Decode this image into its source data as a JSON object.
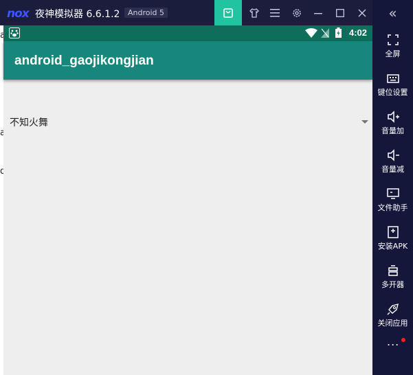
{
  "titlebar": {
    "logo": "nox",
    "title": "夜神模拟器 6.6.1.2",
    "android_badge": "Android 5"
  },
  "statusbar": {
    "time": "4:02"
  },
  "app": {
    "title": "android_gaojikongjian",
    "spinner_value": "不知火舞"
  },
  "sidebar": {
    "collapse": "«",
    "items": [
      {
        "label": "全屏",
        "icon": "fullscreen-icon"
      },
      {
        "label": "键位设置",
        "icon": "keyboard-icon"
      },
      {
        "label": "音量加",
        "icon": "volume-up-icon"
      },
      {
        "label": "音量减",
        "icon": "volume-down-icon"
      },
      {
        "label": "文件助手",
        "icon": "monitor-icon"
      },
      {
        "label": "安装APK",
        "icon": "apk-install-icon"
      },
      {
        "label": "多开器",
        "icon": "multi-instance-icon"
      },
      {
        "label": "关闭应用",
        "icon": "rocket-icon"
      }
    ],
    "more": "..."
  },
  "colors": {
    "titlebar_bg": "#1b1d3d",
    "store_button": "#22c3a1",
    "statusbar": "#0f6e5b",
    "appbar": "#16877a",
    "content_bg": "#eeeeee",
    "notification_dot": "#ff1e1e"
  }
}
